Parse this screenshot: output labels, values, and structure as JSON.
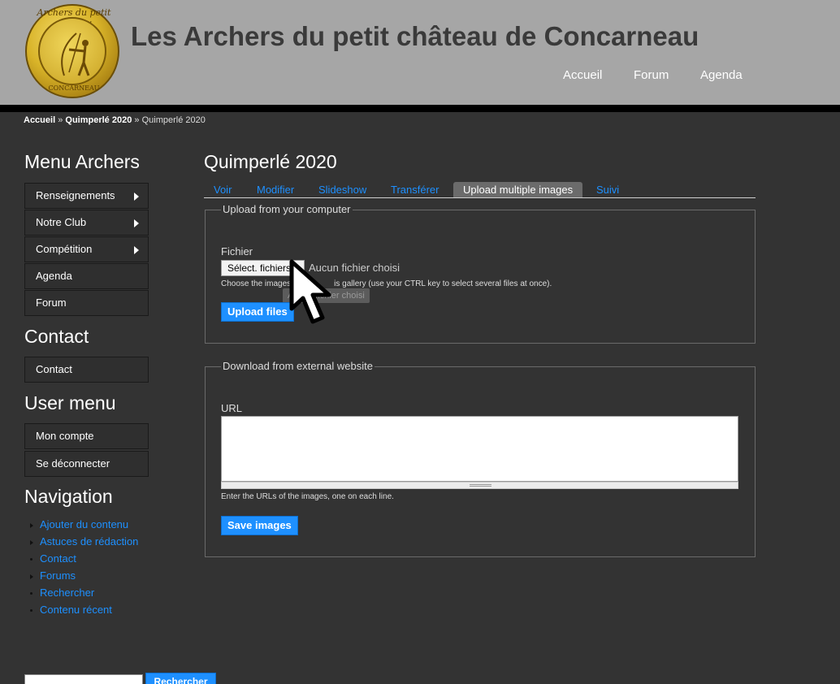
{
  "header": {
    "logo_text_top": "Archers du petit château",
    "logo_text_bottom": "CONCARNEAU",
    "site_title": "Les Archers du petit château de Concarneau",
    "nav": [
      "Accueil",
      "Forum",
      "Agenda"
    ]
  },
  "breadcrumb": {
    "items": [
      "Accueil",
      "Quimperlé 2020"
    ],
    "separator": "»",
    "current": "Quimperlé 2020"
  },
  "sidebar": {
    "menu_archers": {
      "title": "Menu Archers",
      "items": [
        {
          "label": "Renseignements",
          "has_submenu": true
        },
        {
          "label": "Notre Club",
          "has_submenu": true
        },
        {
          "label": "Compétition",
          "has_submenu": true
        },
        {
          "label": "Agenda",
          "has_submenu": false
        },
        {
          "label": "Forum",
          "has_submenu": false
        }
      ]
    },
    "contact": {
      "title": "Contact",
      "items": [
        "Contact"
      ]
    },
    "user_menu": {
      "title": "User menu",
      "items": [
        "Mon compte",
        "Se déconnecter"
      ]
    },
    "navigation": {
      "title": "Navigation",
      "items": [
        "Ajouter du contenu",
        "Astuces de rédaction",
        "Contact",
        "Forums",
        "Rechercher",
        "Contenu récent"
      ]
    },
    "search_button": "Rechercher"
  },
  "main": {
    "title": "Quimperlé 2020",
    "tabs": [
      "Voir",
      "Modifier",
      "Slideshow",
      "Transférer",
      "Upload multiple images",
      "Suivi"
    ],
    "active_tab": "Upload multiple images",
    "upload_section": {
      "legend": "Upload from your computer",
      "field_label": "Fichier",
      "file_button": "Sélect. fichiers",
      "file_status": "Aucun fichier choisi",
      "help": "Choose the images [partly hidden by cursor] this gallery (use your CTRL key to select several files at once).",
      "help_visible_left": "Choose the images",
      "help_visible_right": "is gallery (use your CTRL key to select several files at once).",
      "ghost_tooltip": "Aucun fichier choisi",
      "submit": "Upload files"
    },
    "download_section": {
      "legend": "Download from external website",
      "field_label": "URL",
      "url_value": "",
      "help": "Enter the URLs of the images, one on each line.",
      "submit": "Save images"
    }
  },
  "colors": {
    "background": "#333333",
    "header": "#a6a6a6",
    "accent": "#1e90ff",
    "title_text": "#3a3a3a"
  }
}
